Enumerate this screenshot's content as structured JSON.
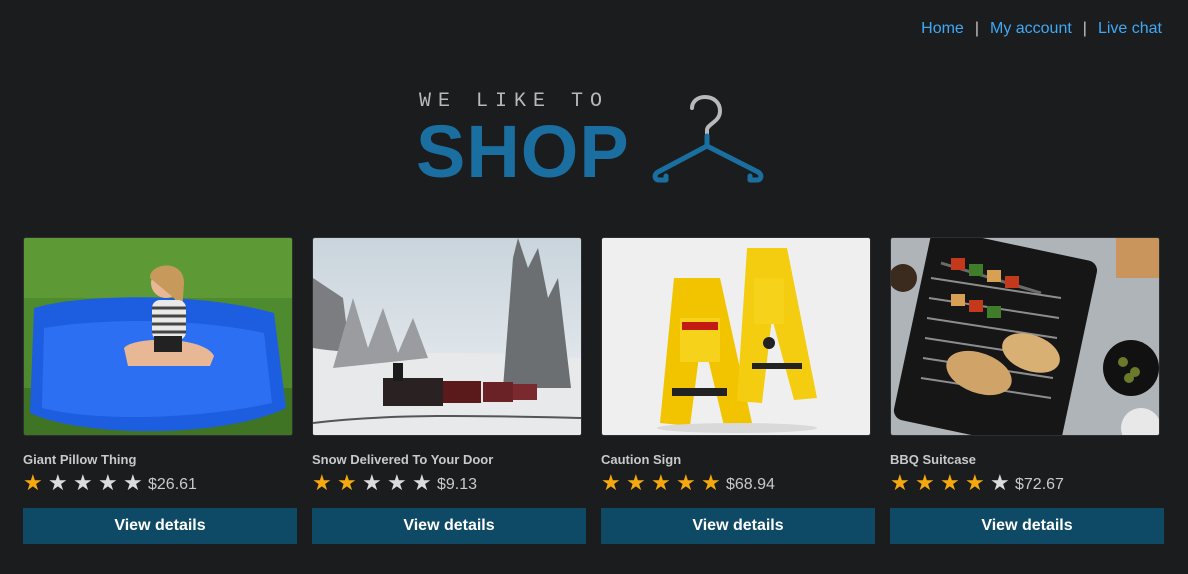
{
  "nav": {
    "home": "Home",
    "account": "My account",
    "chat": "Live chat",
    "separator": "|"
  },
  "logo": {
    "tagline": "WE LIKE TO",
    "word": "SHOP",
    "icon": "hanger-icon",
    "colors": {
      "word": "#1a6fa0",
      "tagline": "#b9b9b9"
    }
  },
  "products": [
    {
      "title": "Giant Pillow Thing",
      "price": "$26.61",
      "rating": 1,
      "image": "blue-bean-bag-photo",
      "button": "View details"
    },
    {
      "title": "Snow Delivered To Your Door",
      "price": "$9.13",
      "rating": 2,
      "image": "snow-train-photo",
      "button": "View details"
    },
    {
      "title": "Caution Sign",
      "price": "$68.94",
      "rating": 5,
      "image": "caution-sign-photo",
      "button": "View details"
    },
    {
      "title": "BBQ Suitcase",
      "price": "$72.67",
      "rating": 4,
      "image": "bbq-grill-photo",
      "button": "View details"
    }
  ],
  "colors": {
    "background": "#1b1c1e",
    "link": "#3fa9f5",
    "button": "#0e4a66",
    "star_on": "#f6a90e",
    "star_off": "#dcdcdc"
  }
}
